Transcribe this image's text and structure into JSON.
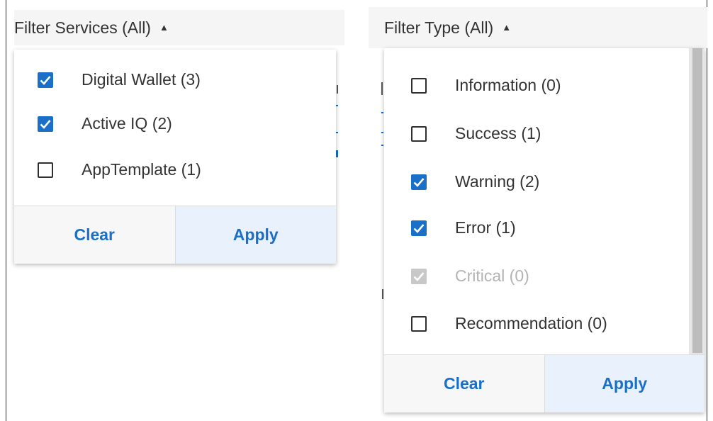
{
  "services_filter": {
    "header_label": "Filter Services (All)",
    "caret_icon": "caret-up-icon",
    "options": [
      {
        "label": "Digital Wallet (3)",
        "checked": true,
        "disabled": false
      },
      {
        "label": "Active IQ (2)",
        "checked": true,
        "disabled": false
      },
      {
        "label": "AppTemplate (1)",
        "checked": false,
        "disabled": false
      }
    ],
    "clear_label": "Clear",
    "apply_label": "Apply"
  },
  "type_filter": {
    "header_label": "Filter Type (All)",
    "caret_icon": "caret-up-icon",
    "options": [
      {
        "label": "Information (0)",
        "checked": false,
        "disabled": false
      },
      {
        "label": "Success (1)",
        "checked": false,
        "disabled": false
      },
      {
        "label": "Warning (2)",
        "checked": true,
        "disabled": false
      },
      {
        "label": "Error (1)",
        "checked": true,
        "disabled": false
      },
      {
        "label": "Critical (0)",
        "checked": true,
        "disabled": true
      },
      {
        "label": "Recommendation (0)",
        "checked": false,
        "disabled": false
      }
    ],
    "clear_label": "Clear",
    "apply_label": "Apply"
  },
  "colors": {
    "accent": "#1a6fc9",
    "disabled": "#c8c8c8",
    "text": "#333333",
    "header_bg": "#f5f5f5",
    "apply_bg": "#e9f2fc"
  }
}
